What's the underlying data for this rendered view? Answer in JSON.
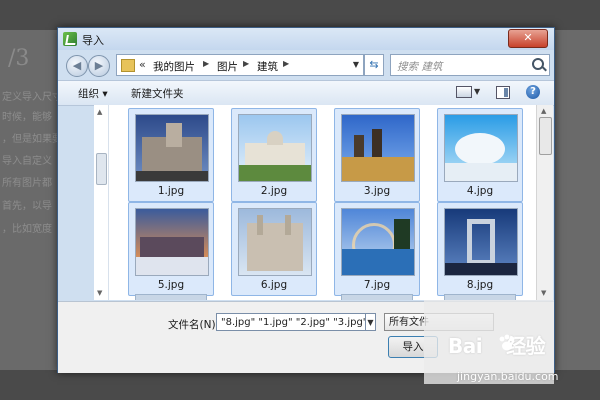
{
  "background": {
    "heading": "/3",
    "lines": [
      "定义导入尺寸",
      "时候，能够",
      "，但是如果要",
      "导入自定义",
      "所有图片都",
      "首先，以导",
      "，比如宽度"
    ]
  },
  "dialog": {
    "title": "导入",
    "close_label": "✕",
    "breadcrumb": {
      "prefix": "«",
      "parts": [
        "我的图片",
        "图片",
        "建筑"
      ]
    },
    "search": {
      "placeholder": "搜索 建筑"
    },
    "toolbar": {
      "organize": "组织 ▾",
      "new_folder": "新建文件夹"
    },
    "files": [
      {
        "name": "1.jpg",
        "scene": "palace"
      },
      {
        "name": "2.jpg",
        "scene": "pavilion"
      },
      {
        "name": "3.jpg",
        "scene": "cathedral-square"
      },
      {
        "name": "4.jpg",
        "scene": "frosted-trees"
      },
      {
        "name": "5.jpg",
        "scene": "snowy-village"
      },
      {
        "name": "6.jpg",
        "scene": "gothic-cathedral"
      },
      {
        "name": "7.jpg",
        "scene": "seaside-rainbow"
      },
      {
        "name": "8.jpg",
        "scene": "modern-tower"
      }
    ],
    "filename": {
      "label": "文件名(N):",
      "value": "\"8.jpg\" \"1.jpg\" \"2.jpg\" \"3.jpg\" \""
    },
    "filetype": {
      "selected": "所有文件"
    },
    "import_label": "导入"
  },
  "watermark": {
    "logo": "Bai",
    "logo_suffix": "经验",
    "url": "jingyan.baidu.com"
  }
}
